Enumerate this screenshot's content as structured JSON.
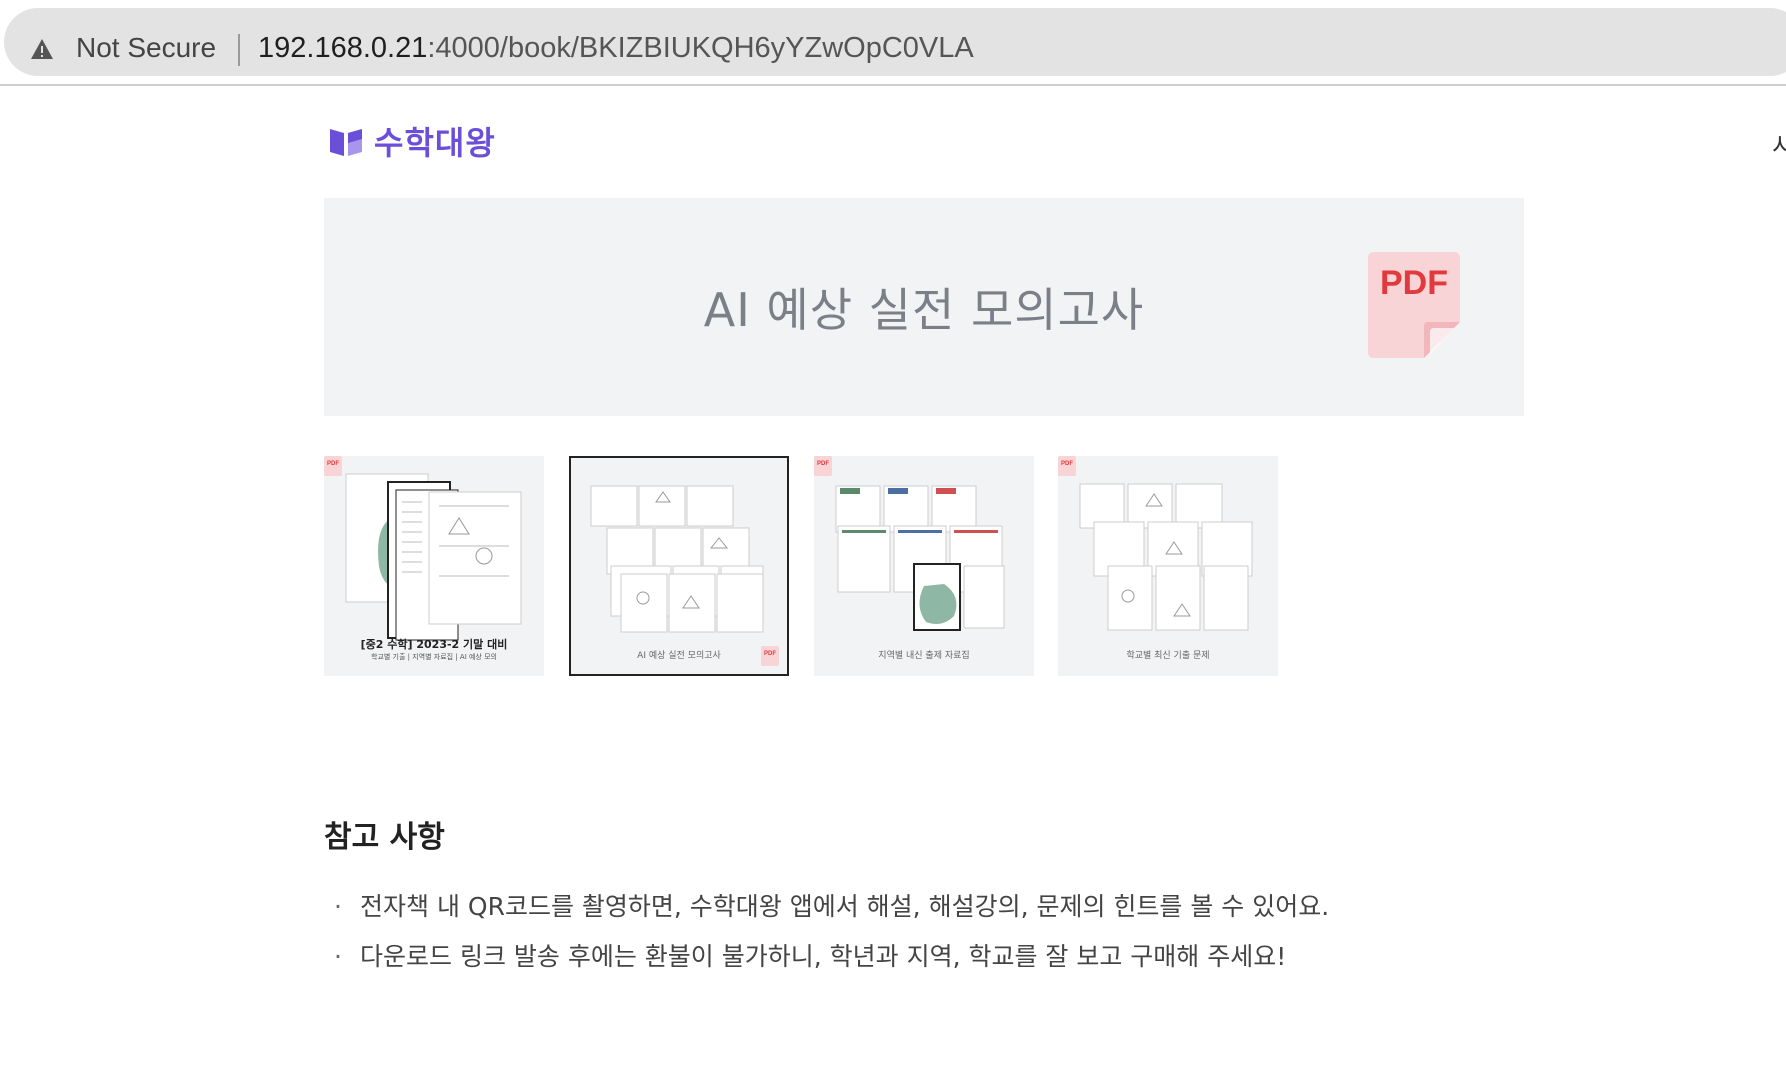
{
  "browser": {
    "security_label": "Not Secure",
    "url_host": "192.168.0.21",
    "url_path": ":4000/book/BKIZBIUKQH6yYZwOpC0VLA"
  },
  "header": {
    "brand_name": "수학대왕",
    "edge_text": "시"
  },
  "preview": {
    "title": "AI 예상 실전 모의고사",
    "badge": "PDF"
  },
  "thumbnails": [
    {
      "caption": "[중2 수학] 2023-2 기말 대비",
      "subcaption": "학교별 기출 | 지역별 자료집 | AI 예상 모의",
      "active": false,
      "badge": "PDF"
    },
    {
      "caption": "AI 예상 실전 모의고사",
      "active": true,
      "badge": "PDF"
    },
    {
      "caption": "지역별 내신 출제 자료집",
      "active": false,
      "badge": "PDF"
    },
    {
      "caption": "학교별 최신 기출 문제",
      "active": false,
      "badge": "PDF"
    }
  ],
  "notes": {
    "title": "참고 사항",
    "bullet": "·",
    "items": [
      "전자책 내 QR코드를 촬영하면, 수학대왕 앱에서 해설, 해설강의, 문제의 힌트를 볼 수 있어요.",
      "다운로드 링크 발송 후에는 환불이 불가하니, 학년과 지역, 학교를 잘 보고 구매해 주세요!"
    ]
  },
  "colors": {
    "brand": "#6b4fd9",
    "pdf_red": "#e0393e",
    "pdf_bg": "#f9d4d6",
    "preview_bg": "#f2f3f5"
  },
  "icons": [
    "warning-icon",
    "book-logo-icon",
    "pdf-icon"
  ]
}
